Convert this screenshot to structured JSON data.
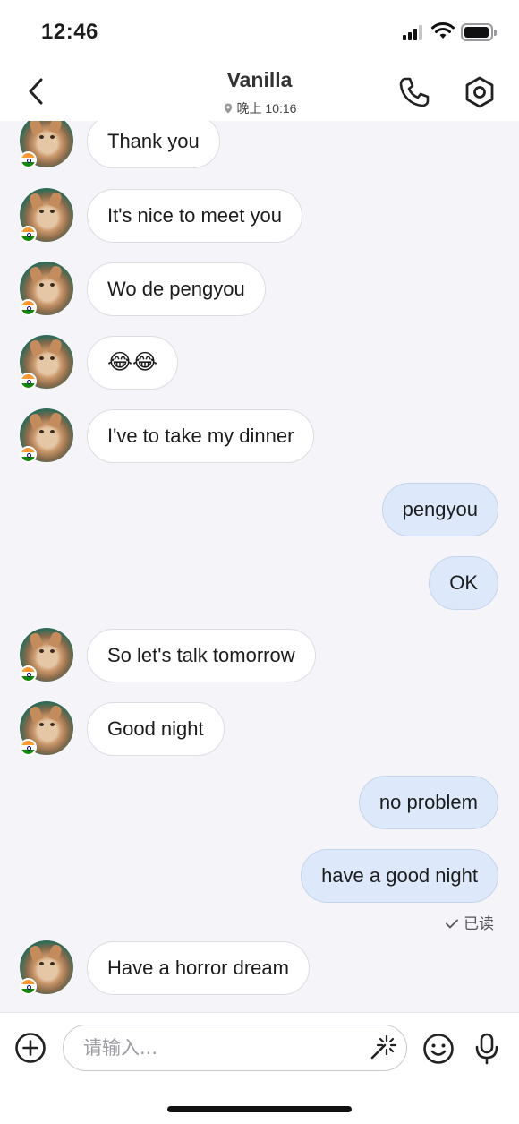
{
  "status_bar": {
    "time": "12:46"
  },
  "header": {
    "contact_name": "Vanilla",
    "contact_status": "晚上 10:16",
    "icons": {
      "back": "chevron-left-icon",
      "location": "location-pin-icon",
      "call": "phone-icon",
      "settings": "hexagon-gear-icon"
    }
  },
  "messages": [
    {
      "direction": "incoming",
      "text": "Thank you"
    },
    {
      "direction": "incoming",
      "text": "It's nice to meet you"
    },
    {
      "direction": "incoming",
      "text": "Wo de pengyou"
    },
    {
      "direction": "incoming",
      "text": "😂😂"
    },
    {
      "direction": "incoming",
      "text": "I've to take my dinner"
    },
    {
      "direction": "outgoing",
      "text": "pengyou"
    },
    {
      "direction": "outgoing",
      "text": "OK"
    },
    {
      "direction": "incoming",
      "text": "So let's talk tomorrow"
    },
    {
      "direction": "incoming",
      "text": "Good night"
    },
    {
      "direction": "outgoing",
      "text": "no problem"
    },
    {
      "direction": "outgoing",
      "text": "have a good night"
    },
    {
      "direction": "incoming",
      "text": "Have a horror dream"
    }
  ],
  "read_receipt": "已读",
  "composer": {
    "placeholder": "请输入...",
    "icons": {
      "plus": "plus-circle-icon",
      "magic": "magic-sparkle-icon",
      "emoji": "emoji-icon",
      "mic": "microphone-icon"
    }
  },
  "colors": {
    "background": "#f4f4f9",
    "incoming_bubble": "#ffffff",
    "outgoing_bubble": "#dde9fb"
  }
}
